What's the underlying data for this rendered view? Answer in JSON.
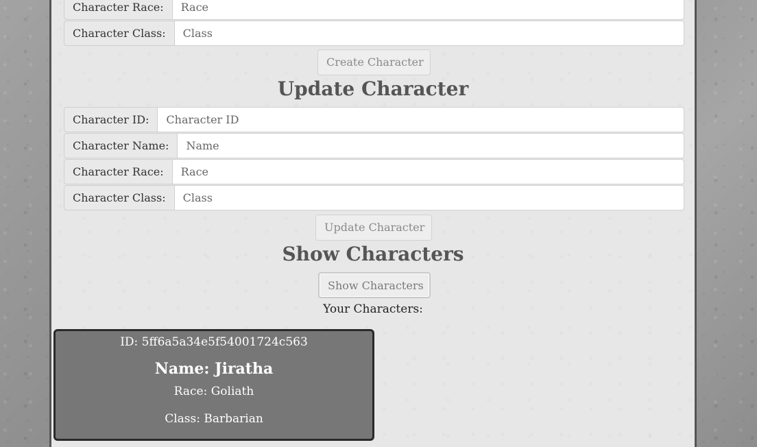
{
  "create_form": {
    "race_label": "Character Race:",
    "race_placeholder": "Race",
    "class_label": "Character Class:",
    "class_placeholder": "Class",
    "submit_label": "Create Character"
  },
  "update_section": {
    "heading": "Update Character",
    "id_label": "Character ID:",
    "id_placeholder": "Character ID",
    "name_label": "Character Name:",
    "name_placeholder": "Name",
    "race_label": "Character Race:",
    "race_placeholder": "Race",
    "class_label": "Character Class:",
    "class_placeholder": "Class",
    "submit_label": "Update Character"
  },
  "show_section": {
    "heading": "Show Characters",
    "button_label": "Show Characters",
    "list_title": "Your Characters:"
  },
  "characters": [
    {
      "id_text": "ID: 5ff6a5a34e5f54001724c563",
      "name_text": "Name: Jiratha",
      "race_text": "Race: Goliath",
      "class_text": "Class: Barbarian"
    }
  ],
  "colors": {
    "card_background": "#777777",
    "panel_background": "#e7e7e7",
    "heading_text": "#555555"
  }
}
